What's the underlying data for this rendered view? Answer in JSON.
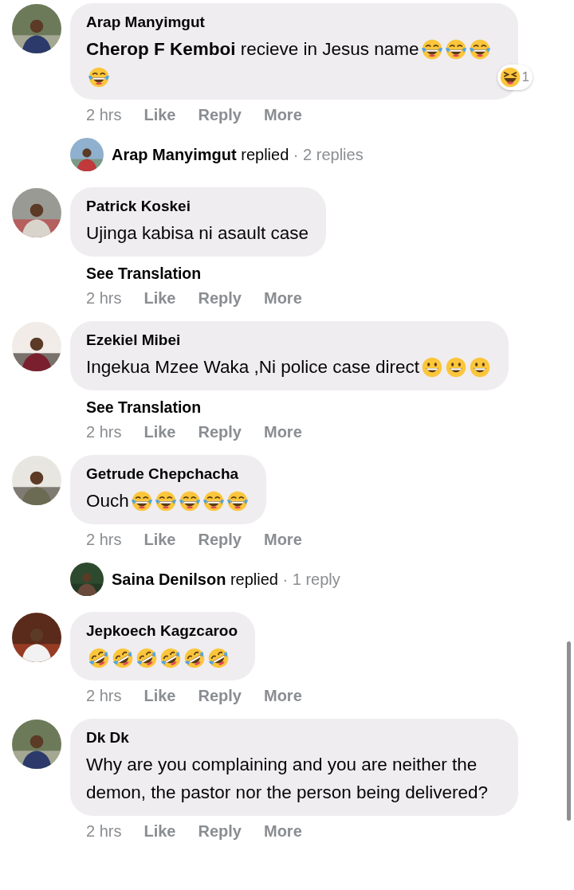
{
  "comments": [
    {
      "kind": "comment",
      "author": "Arap Manyimgut",
      "text": "**Cherop F Kemboi** recieve in Jesus name",
      "emojis": [
        {
          "kind": "joy"
        },
        {
          "kind": "joy"
        },
        {
          "kind": "joy"
        },
        {
          "kind": "joy"
        }
      ],
      "reaction": {
        "kind": "haha",
        "count": "1"
      },
      "time": "2 hrs",
      "actions": [
        "Like",
        "Reply",
        "More"
      ]
    },
    {
      "kind": "replies",
      "author": "Arap Manyimgut",
      "verb": "replied",
      "count": "· 2 replies"
    },
    {
      "kind": "comment",
      "author": "Patrick Koskei",
      "text": "Ujinga kabisa ni asault case",
      "translate": "See Translation",
      "time": "2 hrs",
      "actions": [
        "Like",
        "Reply",
        "More"
      ]
    },
    {
      "kind": "comment",
      "author": "Ezekiel Mibei",
      "text": "Ingekua Mzee Waka ,Ni police case direct",
      "emojis": [
        {
          "kind": "grin"
        },
        {
          "kind": "grin"
        },
        {
          "kind": "grin"
        }
      ],
      "translate": "See Translation",
      "time": "2 hrs",
      "actions": [
        "Like",
        "Reply",
        "More"
      ]
    },
    {
      "kind": "comment",
      "author": "Getrude Chepchacha",
      "text": "Ouch",
      "emojis": [
        {
          "kind": "joy"
        },
        {
          "kind": "joy"
        },
        {
          "kind": "joy"
        },
        {
          "kind": "joy"
        },
        {
          "kind": "joy"
        }
      ],
      "time": "2 hrs",
      "actions": [
        "Like",
        "Reply",
        "More"
      ]
    },
    {
      "kind": "replies",
      "author": "Saina Denilson",
      "verb": "replied",
      "count": "· 1 reply"
    },
    {
      "kind": "comment",
      "author": "Jepkoech Kagzcaroo",
      "emojis": [
        {
          "kind": "rofl"
        },
        {
          "kind": "rofl"
        },
        {
          "kind": "rofl"
        },
        {
          "kind": "rofl"
        },
        {
          "kind": "rofl"
        },
        {
          "kind": "rofl"
        }
      ],
      "time": "2 hrs",
      "actions": [
        "Like",
        "Reply",
        "More"
      ]
    },
    {
      "kind": "comment",
      "author": "Dk Dk",
      "text": "Why are you complaining and you are neither the demon, the pastor nor the person being delivered?",
      "time": "2 hrs",
      "actions": [
        "Like",
        "Reply",
        "More"
      ]
    }
  ]
}
